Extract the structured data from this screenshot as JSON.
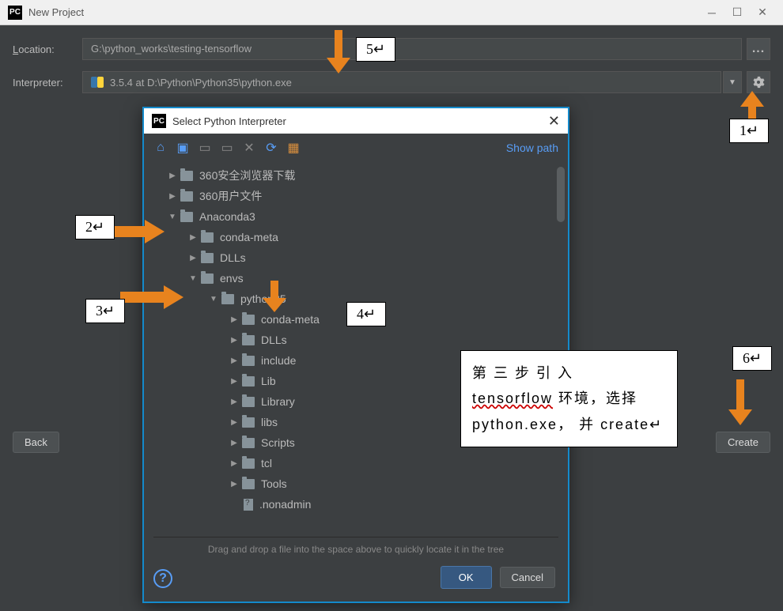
{
  "main": {
    "title": "New Project",
    "location_label": "Location:",
    "location_value": "G:\\python_works\\testing-tensorflow",
    "interpreter_label": "Interpreter:",
    "interpreter_value": "3.5.4 at D:\\Python\\Python35\\python.exe",
    "back_label": "Back",
    "create_label": "Create"
  },
  "dialog": {
    "title": "Select Python Interpreter",
    "show_path": "Show path",
    "hint": "Drag and drop a file into the space above to quickly locate it in the tree",
    "ok_label": "OK",
    "cancel_label": "Cancel",
    "tree": [
      {
        "label": "360安全浏览器下载",
        "indent": 1,
        "expanded": false
      },
      {
        "label": "360用户文件",
        "indent": 1,
        "expanded": false
      },
      {
        "label": "Anaconda3",
        "indent": 1,
        "expanded": true
      },
      {
        "label": "conda-meta",
        "indent": 2,
        "expanded": false
      },
      {
        "label": "DLLs",
        "indent": 2,
        "expanded": false
      },
      {
        "label": "envs",
        "indent": 2,
        "expanded": true
      },
      {
        "label": "python35",
        "indent": 3,
        "expanded": true
      },
      {
        "label": "conda-meta",
        "indent": 4,
        "expanded": false
      },
      {
        "label": "DLLs",
        "indent": 4,
        "expanded": false
      },
      {
        "label": "include",
        "indent": 4,
        "expanded": false
      },
      {
        "label": "Lib",
        "indent": 4,
        "expanded": false
      },
      {
        "label": "Library",
        "indent": 4,
        "expanded": false
      },
      {
        "label": "libs",
        "indent": 4,
        "expanded": false
      },
      {
        "label": "Scripts",
        "indent": 4,
        "expanded": false
      },
      {
        "label": "tcl",
        "indent": 4,
        "expanded": false
      },
      {
        "label": "Tools",
        "indent": 4,
        "expanded": false
      },
      {
        "label": ".nonadmin",
        "indent": 4,
        "is_file": true
      }
    ]
  },
  "callouts": {
    "n1": "1↵",
    "n2": "2↵",
    "n3": "3↵",
    "n4": "4↵",
    "n5": "5↵",
    "n6": "6↵",
    "step_text_1": "第 三 步 引 入",
    "step_text_2_a": "tensorflow",
    "step_text_2_b": " 环境，选择",
    "step_text_3": "python.exe， 并 create↵"
  }
}
